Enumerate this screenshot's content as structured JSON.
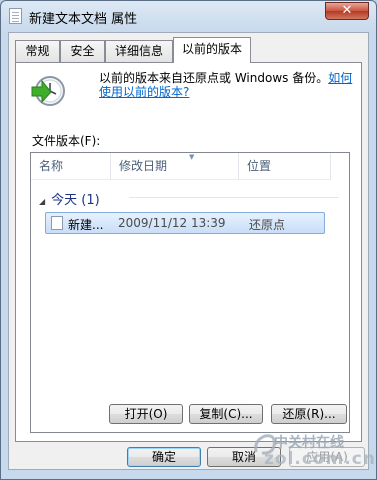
{
  "window": {
    "title": "新建文本文档 属性",
    "close_label": "✕"
  },
  "tabs": [
    {
      "label": "常规"
    },
    {
      "label": "安全"
    },
    {
      "label": "详细信息"
    },
    {
      "label": "以前的版本"
    }
  ],
  "previous_versions": {
    "description": "以前的版本来自还原点或 Windows 备份。",
    "help_link": "如何使用以前的版本?",
    "list_caption": "文件版本(F):",
    "columns": [
      "名称",
      "修改日期",
      "位置"
    ],
    "group": {
      "toggle": "◢",
      "label": "今天 (1)"
    },
    "rows": [
      {
        "name": "新建...",
        "date": "2009/11/12 13:39",
        "location": "还原点"
      }
    ],
    "buttons": {
      "open": "打开(O)",
      "copy": "复制(C)...",
      "restore": "还原(R)..."
    }
  },
  "footer": {
    "ok": "确定",
    "cancel": "取消",
    "apply": "应用(A)"
  },
  "watermark": {
    "line1": "中关村在线",
    "line2": "zol.com.cn"
  },
  "icons": {
    "window": "document-icon",
    "clock": "restore-clock-icon",
    "file": "text-file-icon"
  },
  "colors": {
    "link": "#0066cc",
    "group_header": "#1e3287",
    "selection": "#c8def8"
  }
}
